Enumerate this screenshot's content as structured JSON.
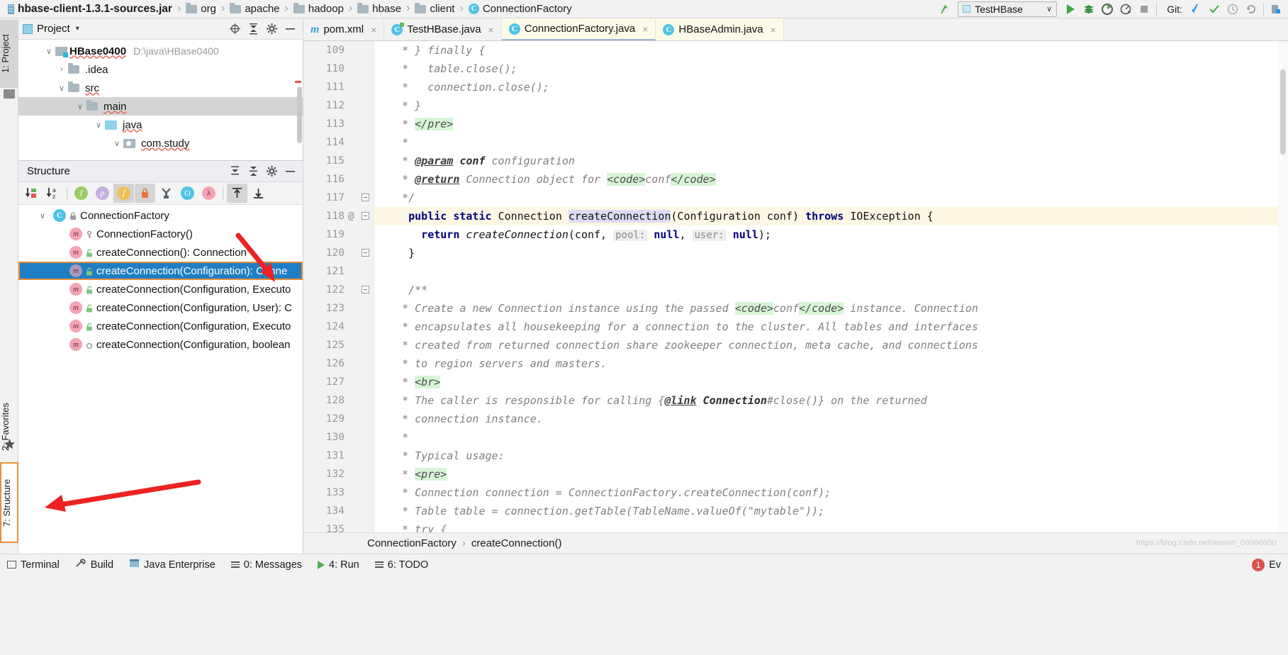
{
  "topbar": {
    "breadcrumbs": [
      {
        "label": "hbase-client-1.3.1-sources.jar",
        "icon": "jar-icon",
        "bold": true
      },
      {
        "label": "org",
        "icon": "folder-icon",
        "bold": false
      },
      {
        "label": "apache",
        "icon": "folder-icon",
        "bold": false
      },
      {
        "label": "hadoop",
        "icon": "folder-icon",
        "bold": false
      },
      {
        "label": "hbase",
        "icon": "folder-icon",
        "bold": false
      },
      {
        "label": "client",
        "icon": "folder-icon",
        "bold": false
      },
      {
        "label": "ConnectionFactory",
        "icon": "class-icon",
        "bold": false
      }
    ],
    "separator": "›",
    "run_config": {
      "name": "TestHBase",
      "caret": "∨"
    },
    "git_label": "Git:",
    "actions": [
      "back-arrow-icon",
      "run-icon",
      "debug-icon",
      "run-with-coverage-icon",
      "profile-icon",
      "stop-icon"
    ],
    "git_actions": [
      "update-project-icon",
      "commit-icon",
      "history-icon",
      "rollback-icon"
    ]
  },
  "left_strip": {
    "project_tab": "1: Project",
    "favorites_tab": "2: Favorites",
    "structure_tab": "7: Structure"
  },
  "project_panel": {
    "title": "Project",
    "caret": "▾",
    "header_icons": [
      "locate-icon",
      "collapse-all-icon",
      "settings-gear-icon",
      "hide-icon"
    ],
    "tree": [
      {
        "label": "HBase0400",
        "path": "D:\\java\\HBase0400",
        "indent": 0,
        "expander": "∨",
        "icon": "module-folder-icon",
        "bold": true,
        "selected": false
      },
      {
        "label": ".idea",
        "path": "",
        "indent": 1,
        "expander": "›",
        "icon": "folder-icon",
        "bold": false,
        "selected": false
      },
      {
        "label": "src",
        "path": "",
        "indent": 1,
        "expander": "∨",
        "icon": "folder-icon",
        "bold": false,
        "selected": false
      },
      {
        "label": "main",
        "path": "",
        "indent": 2,
        "expander": "∨",
        "icon": "folder-icon",
        "bold": false,
        "selected": true
      },
      {
        "label": "java",
        "path": "",
        "indent": 3,
        "expander": "∨",
        "icon": "source-folder-icon",
        "bold": false,
        "selected": false
      },
      {
        "label": "com.study",
        "path": "",
        "indent": 4,
        "expander": "∨",
        "icon": "package-icon",
        "bold": false,
        "selected": false
      }
    ]
  },
  "structure_panel": {
    "title": "Structure",
    "header_icons": [
      "expand-all-icon",
      "collapse-all-icon",
      "settings-gear-icon",
      "hide-icon"
    ],
    "toolbar": [
      {
        "name": "sort-by-visibility-icon",
        "glyph": "↓",
        "active": false
      },
      {
        "name": "sort-alphabetically-icon",
        "glyph": "↓",
        "active": false
      },
      {
        "name": "show-inherited-icon",
        "glyph": "I",
        "active": false
      },
      {
        "name": "show-properties-icon",
        "glyph": "p",
        "active": false
      },
      {
        "name": "show-fields-icon",
        "glyph": "f",
        "active": true
      },
      {
        "name": "show-non-public-icon",
        "glyph": "■",
        "active": true
      },
      {
        "name": "group-methods-icon",
        "glyph": "Y",
        "active": false
      },
      {
        "name": "show-anonymous-classes-icon",
        "glyph": "O",
        "active": false
      },
      {
        "name": "show-lambdas-icon",
        "glyph": "λ",
        "active": false
      },
      {
        "name": "autoscroll-to-source-icon",
        "glyph": "↥",
        "active": true
      },
      {
        "name": "autoscroll-from-source-icon",
        "glyph": "↧",
        "active": false
      }
    ],
    "tree": [
      {
        "label": "ConnectionFactory",
        "indent": 0,
        "expander": "∨",
        "icon": "class-icon",
        "modifier": "lock-icon",
        "selected": false
      },
      {
        "label": "ConnectionFactory()",
        "indent": 1,
        "expander": "",
        "icon": "method-icon",
        "modifier": "key-icon",
        "selected": false
      },
      {
        "label": "createConnection(): Connection",
        "indent": 1,
        "expander": "",
        "icon": "static-method-icon",
        "modifier": "unlock-icon",
        "selected": false
      },
      {
        "label": "createConnection(Configuration): Conne",
        "indent": 1,
        "expander": "",
        "icon": "static-method-icon",
        "modifier": "unlock-icon",
        "selected": true
      },
      {
        "label": "createConnection(Configuration, Executo",
        "indent": 1,
        "expander": "",
        "icon": "static-method-icon",
        "modifier": "unlock-icon",
        "selected": false
      },
      {
        "label": "createConnection(Configuration, User): C",
        "indent": 1,
        "expander": "",
        "icon": "static-method-icon",
        "modifier": "unlock-icon",
        "selected": false
      },
      {
        "label": "createConnection(Configuration, Executo",
        "indent": 1,
        "expander": "",
        "icon": "static-method-icon",
        "modifier": "unlock-icon",
        "selected": false
      },
      {
        "label": "createConnection(Configuration, boolean",
        "indent": 1,
        "expander": "",
        "icon": "static-method-icon",
        "modifier": "circle-icon",
        "selected": false
      }
    ]
  },
  "editor_tabs": [
    {
      "label": "pom.xml",
      "icon": "maven-icon",
      "active": false,
      "yellow": false,
      "close": "×"
    },
    {
      "label": "TestHBase.java",
      "icon": "java-class-icon",
      "active": false,
      "yellow": false,
      "close": "×"
    },
    {
      "label": "ConnectionFactory.java",
      "icon": "java-class-icon",
      "active": true,
      "yellow": true,
      "close": "×"
    },
    {
      "label": "HBaseAdmin.java",
      "icon": "java-class-icon",
      "active": false,
      "yellow": true,
      "close": "×"
    }
  ],
  "editor": {
    "first_line": 109,
    "highlighted_line": 118,
    "annotation_marker": "@",
    "lines": [
      {
        "n": 109,
        "segments": [
          {
            "t": " * } finally {",
            "c": "cmt"
          }
        ]
      },
      {
        "n": 110,
        "segments": [
          {
            "t": " *   table.close();",
            "c": "cmt"
          }
        ]
      },
      {
        "n": 111,
        "segments": [
          {
            "t": " *   connection.close();",
            "c": "cmt"
          }
        ]
      },
      {
        "n": 112,
        "segments": [
          {
            "t": " * }",
            "c": "cmt"
          }
        ]
      },
      {
        "n": 113,
        "segments": [
          {
            "t": " * ",
            "c": "cmt"
          },
          {
            "t": "</pre>",
            "c": "tag"
          }
        ]
      },
      {
        "n": 114,
        "segments": [
          {
            "t": " *",
            "c": "cmt"
          }
        ]
      },
      {
        "n": 115,
        "segments": [
          {
            "t": " * ",
            "c": "cmt"
          },
          {
            "t": "@param",
            "c": "jdoc-tag"
          },
          {
            "t": " ",
            "c": "cmt"
          },
          {
            "t": "conf",
            "c": "jdoc-b"
          },
          {
            "t": " configuration",
            "c": "cmt"
          }
        ]
      },
      {
        "n": 116,
        "segments": [
          {
            "t": " * ",
            "c": "cmt"
          },
          {
            "t": "@return",
            "c": "jdoc-tag"
          },
          {
            "t": " Connection object for ",
            "c": "cmt"
          },
          {
            "t": "<code>",
            "c": "tag"
          },
          {
            "t": "conf",
            "c": "cmt"
          },
          {
            "t": "</code>",
            "c": "tag"
          }
        ]
      },
      {
        "n": 117,
        "segments": [
          {
            "t": " */",
            "c": "cmt"
          }
        ],
        "fold": true
      },
      {
        "n": 118,
        "segments": [
          {
            "t": "public static ",
            "c": "kw"
          },
          {
            "t": "Connection ",
            "c": "plain"
          },
          {
            "t": "createConnection",
            "c": "mname"
          },
          {
            "t": "(Configuration conf) ",
            "c": "plain"
          },
          {
            "t": "throws ",
            "c": "kw"
          },
          {
            "t": "IOException {",
            "c": "plain"
          }
        ],
        "highlight": true,
        "fold": true,
        "annotation": "@"
      },
      {
        "n": 119,
        "segments": [
          {
            "t": "  return ",
            "c": "kw"
          },
          {
            "t": "createConnection",
            "c": "plain-italic"
          },
          {
            "t": "(conf, ",
            "c": "plain"
          },
          {
            "t": "pool:",
            "c": "hint"
          },
          {
            "t": " ",
            "c": "plain"
          },
          {
            "t": "null",
            "c": "kw"
          },
          {
            "t": ", ",
            "c": "plain"
          },
          {
            "t": "user:",
            "c": "hint"
          },
          {
            "t": " ",
            "c": "plain"
          },
          {
            "t": "null",
            "c": "kw"
          },
          {
            "t": ");",
            "c": "plain"
          }
        ]
      },
      {
        "n": 120,
        "segments": [
          {
            "t": "}",
            "c": "plain"
          }
        ],
        "fold": true
      },
      {
        "n": 121,
        "segments": [
          {
            "t": "",
            "c": "plain"
          }
        ]
      },
      {
        "n": 122,
        "segments": [
          {
            "t": "/**",
            "c": "cmt"
          }
        ],
        "fold": true
      },
      {
        "n": 123,
        "segments": [
          {
            "t": " * Create a new Connection instance using the passed ",
            "c": "cmt"
          },
          {
            "t": "<code>",
            "c": "tag"
          },
          {
            "t": "conf",
            "c": "cmt"
          },
          {
            "t": "</code>",
            "c": "tag"
          },
          {
            "t": " instance. Connection",
            "c": "cmt"
          }
        ]
      },
      {
        "n": 124,
        "segments": [
          {
            "t": " * encapsulates all housekeeping for a connection to the cluster. All tables and interfaces",
            "c": "cmt"
          }
        ]
      },
      {
        "n": 125,
        "segments": [
          {
            "t": " * created from returned connection share zookeeper connection, meta cache, and connections",
            "c": "cmt"
          }
        ]
      },
      {
        "n": 126,
        "segments": [
          {
            "t": " * to region servers and masters.",
            "c": "cmt"
          }
        ]
      },
      {
        "n": 127,
        "segments": [
          {
            "t": " * ",
            "c": "cmt"
          },
          {
            "t": "<br>",
            "c": "tag"
          }
        ]
      },
      {
        "n": 128,
        "segments": [
          {
            "t": " * The caller is responsible for calling {",
            "c": "cmt"
          },
          {
            "t": "@link",
            "c": "jdoc-tag"
          },
          {
            "t": " ",
            "c": "cmt"
          },
          {
            "t": "Connection",
            "c": "jdoc-b"
          },
          {
            "t": "#close()} on the returned",
            "c": "cmt"
          }
        ]
      },
      {
        "n": 129,
        "segments": [
          {
            "t": " * connection instance.",
            "c": "cmt"
          }
        ]
      },
      {
        "n": 130,
        "segments": [
          {
            "t": " *",
            "c": "cmt"
          }
        ]
      },
      {
        "n": 131,
        "segments": [
          {
            "t": " * Typical usage:",
            "c": "cmt"
          }
        ]
      },
      {
        "n": 132,
        "segments": [
          {
            "t": " * ",
            "c": "cmt"
          },
          {
            "t": "<pre>",
            "c": "tag"
          }
        ]
      },
      {
        "n": 133,
        "segments": [
          {
            "t": " * Connection connection = ConnectionFactory.createConnection(conf);",
            "c": "cmt"
          }
        ]
      },
      {
        "n": 134,
        "segments": [
          {
            "t": " * Table table = connection.getTable(TableName.valueOf(\"mytable\"));",
            "c": "cmt"
          }
        ]
      },
      {
        "n": 135,
        "segments": [
          {
            "t": " * try {",
            "c": "cmt"
          }
        ]
      }
    ]
  },
  "editor_breadcrumb": {
    "items": [
      "ConnectionFactory",
      "createConnection()"
    ],
    "separator": "›"
  },
  "statusbar": {
    "items": [
      {
        "label": "Terminal",
        "icon": "terminal-icon"
      },
      {
        "label": "Build",
        "icon": "build-icon"
      },
      {
        "label": "Java Enterprise",
        "icon": "java-enterprise-icon"
      },
      {
        "label": "0: Messages",
        "icon": "messages-icon"
      },
      {
        "label": "4: Run",
        "icon": "run-icon"
      },
      {
        "label": "6: TODO",
        "icon": "todo-icon"
      }
    ],
    "notification_count": "1",
    "event_log": "Ev"
  },
  "colors": {
    "accent_selection": "#1f7ec4",
    "highlight_outline": "#e8903a",
    "tab_active_bg": "#fbfbe7",
    "line_highlight": "#fdf8e3",
    "arrow_red": "#ee2222",
    "keyword_blue": "#000080",
    "tag_green_bg": "#d6f5d6"
  }
}
